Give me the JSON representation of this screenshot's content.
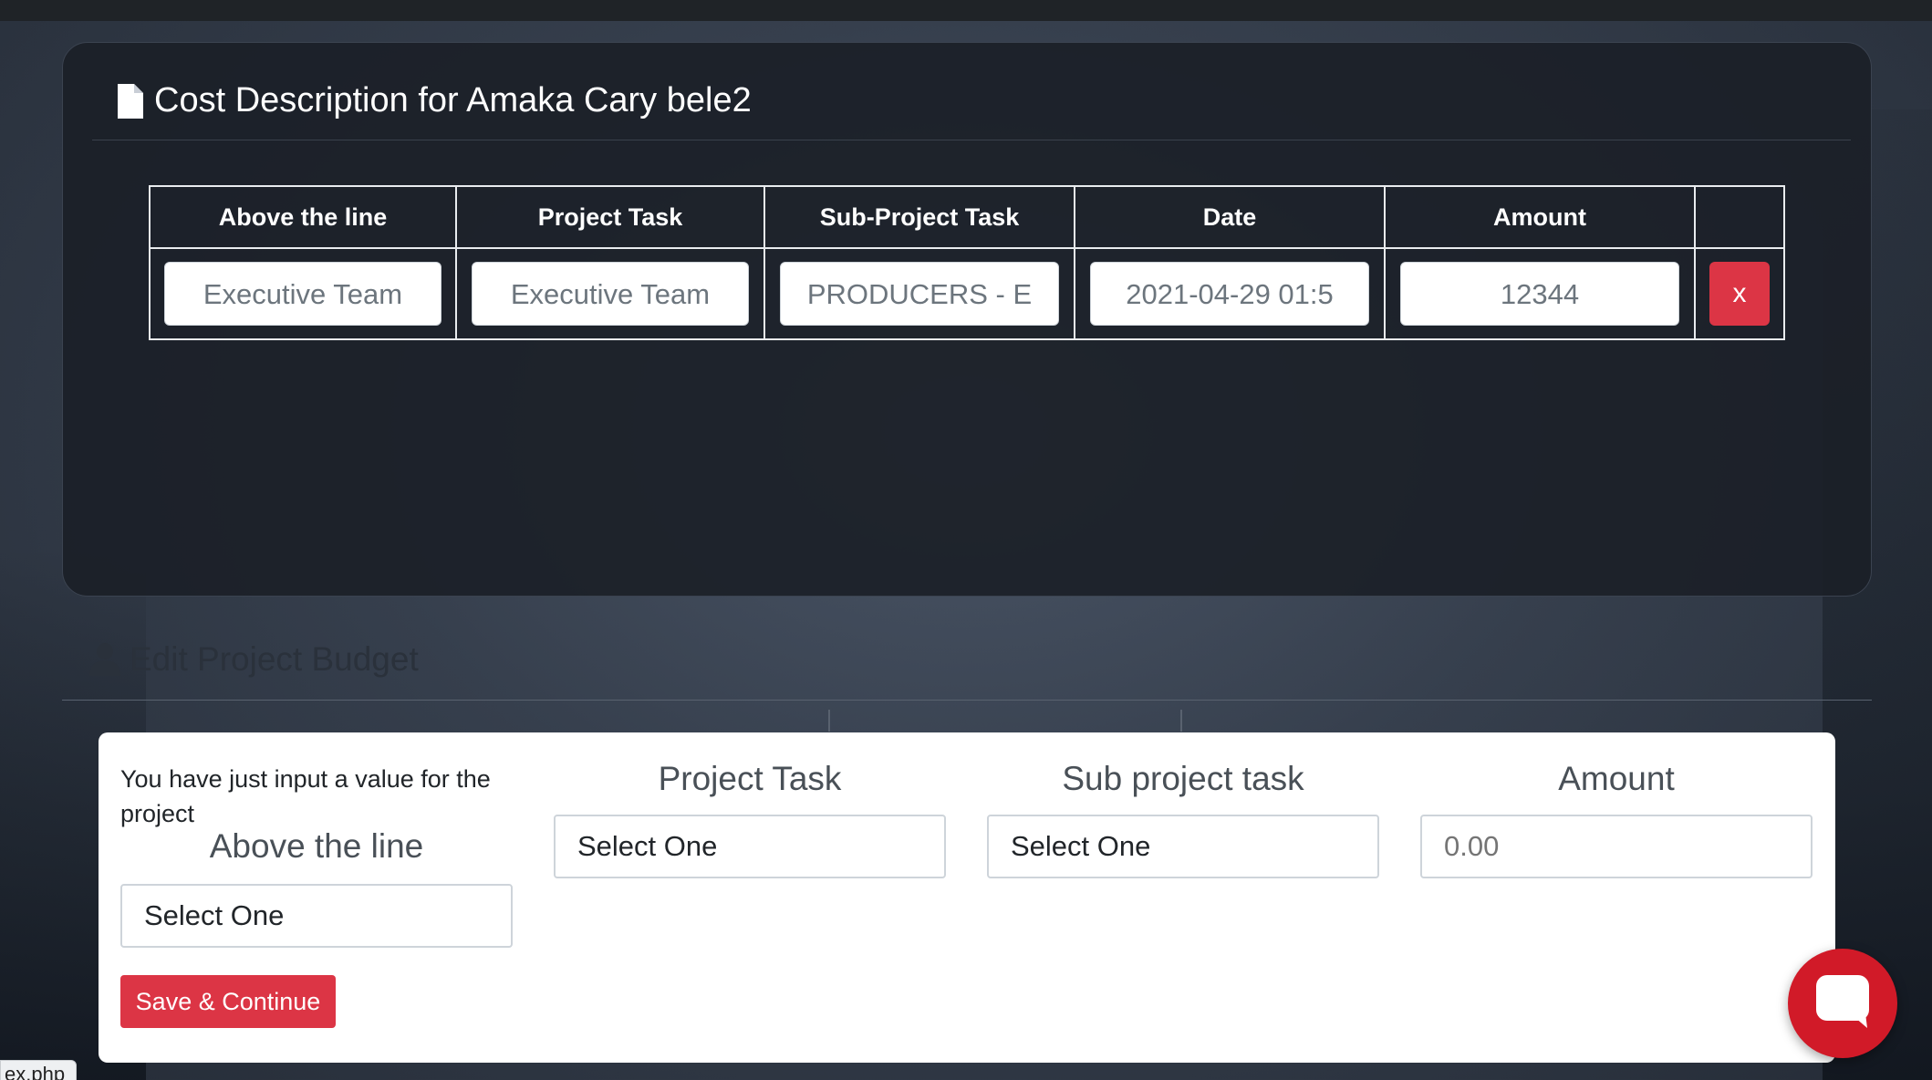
{
  "colors": {
    "accent_red": "#dc3545",
    "chat_red": "#d11a28",
    "panel_bg": "#1b1f27"
  },
  "cost_panel": {
    "icon": "document-icon",
    "title": "Cost Description for Amaka Cary bele2",
    "columns": [
      "Above the line",
      "Project Task",
      "Sub-Project Task",
      "Date",
      "Amount",
      ""
    ],
    "rows": [
      {
        "above_the_line": "Executive Team",
        "project_task": "Executive Team",
        "sub_project_task": "PRODUCERS - E",
        "date": "2021-04-29 01:5",
        "amount": "12344",
        "delete_label": "x"
      }
    ]
  },
  "edit_section": {
    "icon": "user-icon",
    "title": "Edit Project Budget"
  },
  "form": {
    "note": "You have just input a value for the project",
    "above_the_line": {
      "label": "Above the line",
      "value": "Select One"
    },
    "project_task": {
      "label": "Project Task",
      "value": "Select One"
    },
    "sub_project_task": {
      "label": "Sub project task",
      "value": "Select One"
    },
    "amount": {
      "label": "Amount",
      "placeholder": "0.00"
    },
    "save_label": "Save & Continue"
  },
  "chat": {
    "icon": "chat-bubble-icon"
  },
  "status_bar": {
    "url_fragment": "ex.php"
  }
}
